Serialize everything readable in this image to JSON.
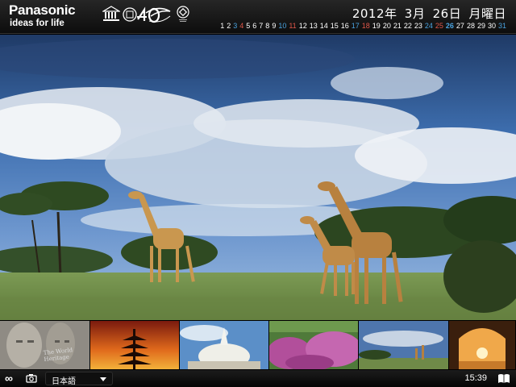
{
  "header": {
    "brand_name": "Panasonic",
    "brand_tagline": "ideas for life",
    "logos": [
      "unesco-emblem",
      "40-years-anniversary-logo",
      "world-heritage-emblem"
    ],
    "date": {
      "year": "2012年",
      "month": "3月",
      "day": "26日",
      "weekday": "月曜日"
    },
    "calendar_days": [
      {
        "day": "1",
        "kind": "weekday"
      },
      {
        "day": "2",
        "kind": "weekday"
      },
      {
        "day": "3",
        "kind": "sat"
      },
      {
        "day": "4",
        "kind": "sun"
      },
      {
        "day": "5",
        "kind": "weekday"
      },
      {
        "day": "6",
        "kind": "weekday"
      },
      {
        "day": "7",
        "kind": "weekday"
      },
      {
        "day": "8",
        "kind": "weekday"
      },
      {
        "day": "9",
        "kind": "weekday"
      },
      {
        "day": "10",
        "kind": "sat"
      },
      {
        "day": "11",
        "kind": "sun"
      },
      {
        "day": "12",
        "kind": "weekday"
      },
      {
        "day": "13",
        "kind": "weekday"
      },
      {
        "day": "14",
        "kind": "weekday"
      },
      {
        "day": "15",
        "kind": "weekday"
      },
      {
        "day": "16",
        "kind": "weekday"
      },
      {
        "day": "17",
        "kind": "sat"
      },
      {
        "day": "18",
        "kind": "sun"
      },
      {
        "day": "19",
        "kind": "weekday"
      },
      {
        "day": "20",
        "kind": "weekday"
      },
      {
        "day": "21",
        "kind": "weekday"
      },
      {
        "day": "22",
        "kind": "weekday"
      },
      {
        "day": "23",
        "kind": "weekday"
      },
      {
        "day": "24",
        "kind": "sat"
      },
      {
        "day": "25",
        "kind": "sun"
      },
      {
        "day": "26",
        "kind": "today"
      },
      {
        "day": "27",
        "kind": "weekday"
      },
      {
        "day": "28",
        "kind": "weekday"
      },
      {
        "day": "29",
        "kind": "weekday"
      },
      {
        "day": "30",
        "kind": "weekday"
      },
      {
        "day": "31",
        "kind": "sat"
      }
    ]
  },
  "main_photo": {
    "subject": "giraffes-on-savanna"
  },
  "thumbnails": [
    {
      "subject": "stone-carved-faces",
      "caption": "The World Heritage"
    },
    {
      "subject": "pagoda-at-sunset",
      "caption": ""
    },
    {
      "subject": "white-stupa",
      "caption": ""
    },
    {
      "subject": "purple-flower-field",
      "caption": ""
    },
    {
      "subject": "giraffes-on-savanna",
      "caption": ""
    },
    {
      "subject": "arch-at-sunset",
      "caption": ""
    }
  ],
  "footer": {
    "loop_icon": "infinity-icon",
    "camera_icon": "camera-icon",
    "language": "日本語",
    "time": "15:39",
    "book_icon": "book-icon"
  },
  "colors": {
    "sunday": "#e0574a",
    "saturday": "#4aa3e0",
    "today": "#4aa3e0"
  }
}
